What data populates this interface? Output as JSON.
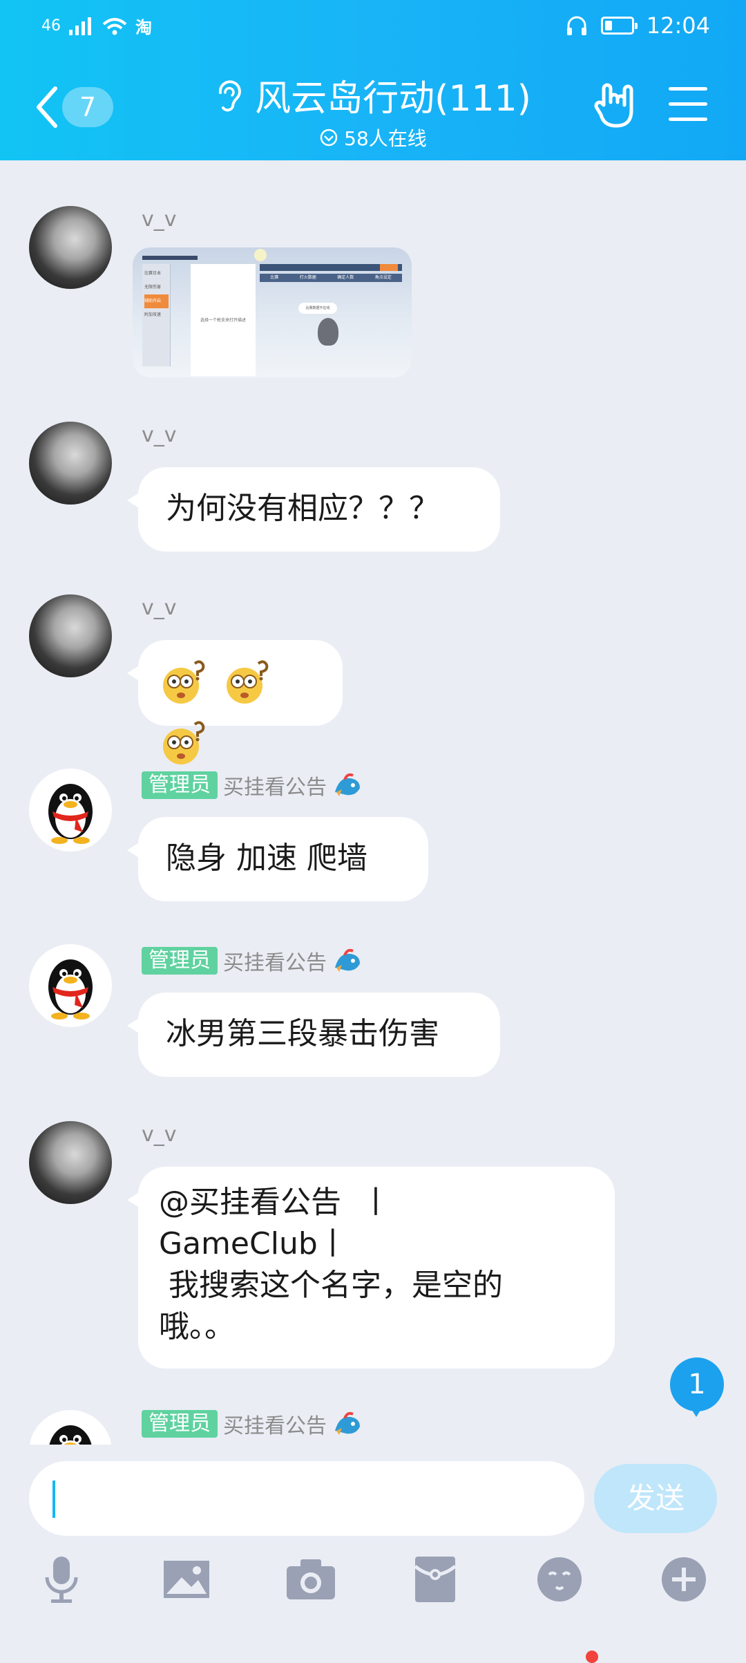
{
  "status_bar": {
    "network": "46",
    "carrier_app": "淘",
    "time": "12:04"
  },
  "header": {
    "unread_count": "7",
    "title": "风云岛行动(111)",
    "online": "58人在线"
  },
  "messages": [
    {
      "sender": "v_v",
      "type": "image"
    },
    {
      "sender": "v_v",
      "type": "text",
      "text": "为何没有相应？？？"
    },
    {
      "sender": "v_v",
      "type": "emoji",
      "emoji": [
        "confused-face-icon",
        "confused-face-icon",
        "confused-face-icon"
      ]
    },
    {
      "sender": "买挂看公告",
      "role": "管理员",
      "type": "text",
      "text": "隐身 加速 爬墙"
    },
    {
      "sender": "买挂看公告",
      "role": "管理员",
      "type": "text",
      "text": "冰男第三段暴击伤害"
    },
    {
      "sender": "v_v",
      "type": "text",
      "lines": [
        "@买挂看公告  丨",
        "GameClub丨",
        " 我搜索这个名字，是空的",
        "哦。。"
      ]
    },
    {
      "sender": "买挂看公告",
      "role": "管理员",
      "type": "partial"
    }
  ],
  "image_preview": {
    "menu": [
      "比赛日本",
      "无限伤害",
      "辅助开启",
      "附加攻速"
    ],
    "panel_text": "选择一个枪支来打开描述",
    "tabs": [
      "比赛",
      "打火数据",
      "确定人数",
      "角点设定"
    ],
    "bubble_text": "比赛数据不在线"
  },
  "new_message_count": "1",
  "input": {
    "value": "",
    "send_label": "发送"
  },
  "toolbar": [
    "mic-icon",
    "image-icon",
    "camera-icon",
    "red-packet-icon",
    "emoji-icon",
    "plus-icon"
  ],
  "colors": {
    "header_start": "#12c4f4",
    "header_end": "#12a8f5",
    "admin_badge": "#5fd2a0",
    "accent": "#1ba1ee",
    "bg": "#eaedf4"
  }
}
